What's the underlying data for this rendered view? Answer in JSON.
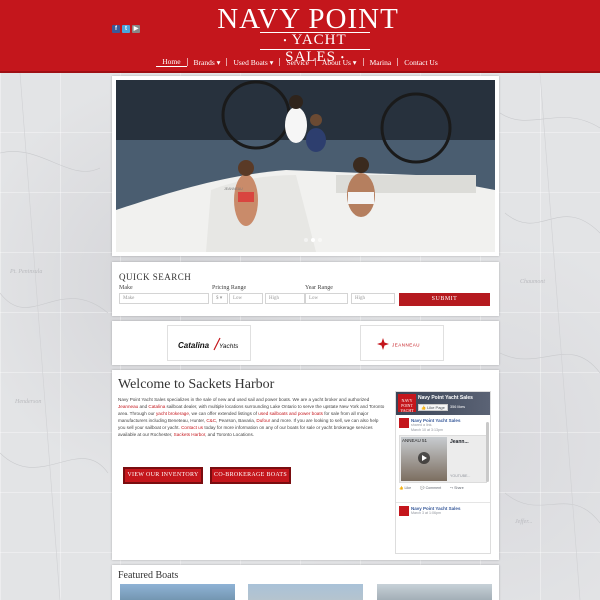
{
  "brand": {
    "logo_line1": "NAVY POINT",
    "logo_line2": "YACHT SALES",
    "accent_color": "#c4161c"
  },
  "social": [
    {
      "icon": "facebook-icon",
      "glyph": "f"
    },
    {
      "icon": "twitter-icon",
      "glyph": "t"
    },
    {
      "icon": "youtube-icon",
      "glyph": "▶"
    }
  ],
  "nav": {
    "items": [
      {
        "label": "Home",
        "active": true
      },
      {
        "label": "Brands ▾"
      },
      {
        "label": "Used Boats ▾"
      },
      {
        "label": "Service"
      },
      {
        "label": "About Us ▾"
      },
      {
        "label": "Marina"
      },
      {
        "label": "Contact Us"
      }
    ]
  },
  "hero": {
    "slides": 3,
    "active_slide": 2
  },
  "quick_search": {
    "title": "QUICK SEARCH",
    "make_label": "Make",
    "make_placeholder": "Make",
    "price_label": "Pricing Range",
    "price_select": "$ ▾",
    "price_low": "Low",
    "price_high": "High",
    "year_label": "Year Range",
    "year_low": "Low",
    "year_high": "High",
    "submit": "SUBMIT"
  },
  "brands": [
    {
      "name": "Catalina Yachts",
      "icon": "catalina-logo"
    },
    {
      "name": "JEANNEAU",
      "icon": "jeanneau-logo"
    }
  ],
  "welcome": {
    "title": "Welcome to Sackets Harbor",
    "p1": "Navy Point Yacht Sales specializes in the sale of new and used sail and power boats. We are a yacht broker and authorized ",
    "link_jeanneau": "Jeanneau",
    "p2": " and ",
    "link_catalina": "Catalina",
    "p3": " sailboat dealer, with multiple locations surrounding Lake Ontario to serve the upstate New York and Toronto area. Through our ",
    "link_brokerage": "yacht brokerage",
    "p4": ", we can offer extended listings of ",
    "link_used": "used sailboats and power boats",
    "p5": " for sale from all major manufacturers including Beneteau, Hunter, ",
    "link_cc": "C&C",
    "p6": ", Pearson, Bavaria, ",
    "link_dufour": "Dufour",
    "p7": " and more.  If you are looking to sell, we can also help you sell your sailboat or yacht. ",
    "link_contact": "Contact us",
    "p8": " today for more information on any of our boats for sale or yacht brokerage services available at our Rochester, ",
    "link_sackets": "Sackets Harbor",
    "p9": ", and Toronto Locations.",
    "btn_inventory": "VIEW OUR INVENTORY",
    "btn_cobrokerage": "CO-BROKERAGE BOATS"
  },
  "facebook": {
    "page_name": "Navy Point Yacht Sales",
    "like_button": "👍 Like Page",
    "likes_count": "356 likes",
    "logo_text": "NAVY POINT YACHT",
    "post1_name": "Navy Point Yacht Sales",
    "post1_sub1": "shared a link.",
    "post1_sub2": "March 10 at 3:13pm",
    "media_title": "Jeann...",
    "media_caption": "ANNEAU 51",
    "media_source": "YOUTUBE...",
    "like": "Like",
    "comment": "Comment",
    "share": "Share",
    "post2_name": "Navy Point Yacht Sales",
    "post2_sub": "March 3 at 1:06pm"
  },
  "featured": {
    "title": "Featured  Boats"
  }
}
